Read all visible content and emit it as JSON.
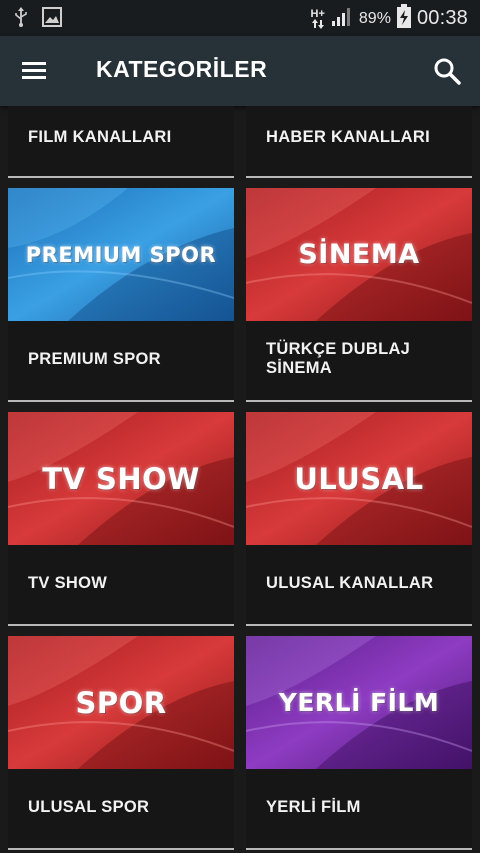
{
  "status_bar": {
    "network_type": "H+",
    "battery_percent": "89%",
    "time": "00:38"
  },
  "app_bar": {
    "title": "KATEGORİLER",
    "menu_icon": "hamburger-menu-icon",
    "search_icon": "search-icon"
  },
  "categories": [
    {
      "caption": "FILM KANALLARI"
    },
    {
      "caption": "HABER KANALLARI"
    },
    {
      "caption": "PREMIUM SPOR",
      "thumb_text": "PREMIUM SPOR",
      "color": "blue"
    },
    {
      "caption": "TÜRKÇE DUBLAJ SİNEMA",
      "thumb_text": "SİNEMA",
      "color": "red"
    },
    {
      "caption": "TV SHOW",
      "thumb_text": "TV SHOW",
      "color": "red"
    },
    {
      "caption": "ULUSAL KANALLAR",
      "thumb_text": "ULUSAL",
      "color": "red"
    },
    {
      "caption": "ULUSAL SPOR",
      "thumb_text": "SPOR",
      "color": "red"
    },
    {
      "caption": "YERLİ FİLM",
      "thumb_text": "YERLİ FİLM",
      "color": "purple"
    }
  ],
  "colors": {
    "app_bar": "#273238",
    "status_bar": "#191c1f",
    "card_background": "#161616",
    "red": "#c32a2c",
    "blue": "#2a8fd6",
    "purple": "#7a2ea8"
  }
}
